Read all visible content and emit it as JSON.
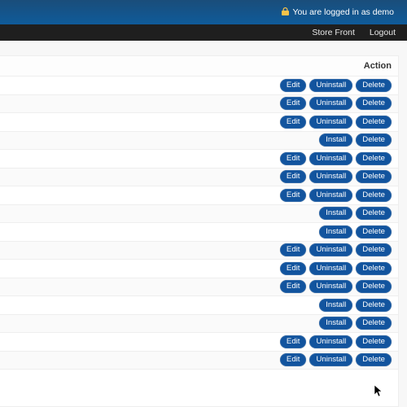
{
  "header": {
    "logged_in_text": "You are logged in as demo",
    "lock_icon": "lock"
  },
  "topnav": {
    "store_front": "Store Front",
    "logout": "Logout"
  },
  "table": {
    "action_header": "Action",
    "labels": {
      "edit": "Edit",
      "uninstall": "Uninstall",
      "install": "Install",
      "delete": "Delete"
    },
    "rows": [
      {
        "buttons": [
          "edit",
          "uninstall",
          "delete"
        ]
      },
      {
        "buttons": [
          "edit",
          "uninstall",
          "delete"
        ]
      },
      {
        "buttons": [
          "edit",
          "uninstall",
          "delete"
        ]
      },
      {
        "buttons": [
          "install",
          "delete"
        ]
      },
      {
        "buttons": [
          "edit",
          "uninstall",
          "delete"
        ]
      },
      {
        "buttons": [
          "edit",
          "uninstall",
          "delete"
        ]
      },
      {
        "buttons": [
          "edit",
          "uninstall",
          "delete"
        ]
      },
      {
        "buttons": [
          "install",
          "delete"
        ]
      },
      {
        "buttons": [
          "install",
          "delete"
        ]
      },
      {
        "buttons": [
          "edit",
          "uninstall",
          "delete"
        ]
      },
      {
        "buttons": [
          "edit",
          "uninstall",
          "delete"
        ]
      },
      {
        "buttons": [
          "edit",
          "uninstall",
          "delete"
        ]
      },
      {
        "buttons": [
          "install",
          "delete"
        ]
      },
      {
        "buttons": [
          "install",
          "delete"
        ]
      },
      {
        "buttons": [
          "edit",
          "uninstall",
          "delete"
        ]
      },
      {
        "buttons": [
          "edit",
          "uninstall",
          "delete"
        ]
      }
    ]
  }
}
